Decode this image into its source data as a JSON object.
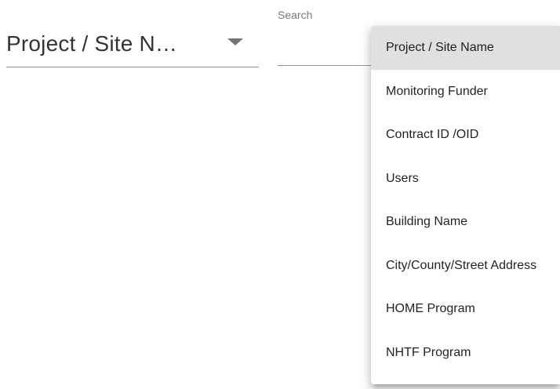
{
  "filter_select": {
    "value": "Project / Site N…"
  },
  "search": {
    "label": "Search",
    "value": "",
    "placeholder": ""
  },
  "menu": {
    "selected_index": 0,
    "items": [
      {
        "label": "Project / Site Name"
      },
      {
        "label": "Monitoring Funder"
      },
      {
        "label": "Contract ID /OID"
      },
      {
        "label": "Users"
      },
      {
        "label": "Building Name"
      },
      {
        "label": "City/County/Street Address"
      },
      {
        "label": "HOME Program"
      },
      {
        "label": "NHTF Program"
      }
    ]
  },
  "colors": {
    "selected_item_bg": "#e0e0e0",
    "underline": "#9e9e9e",
    "text": "#212121"
  },
  "icons": {
    "select_arrow": "triangle-down-icon"
  }
}
